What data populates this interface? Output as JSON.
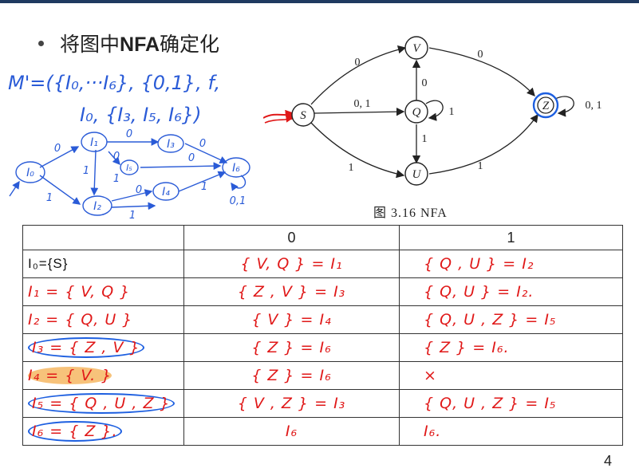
{
  "slide": {
    "bullet_prefix": "将图中",
    "bullet_bold": "NFA",
    "bullet_suffix": "确定化",
    "caption": "图 3.16   NFA",
    "page_number": "4"
  },
  "nfa": {
    "states": [
      "S",
      "V",
      "Q",
      "U",
      "Z"
    ],
    "edge_labels": {
      "s_v": "0",
      "v_z": "0",
      "s_q": "0, 1",
      "q_v": "0",
      "q_loop": "1",
      "q_u": "1",
      "s_u": "1",
      "u_z": "1",
      "z_loop": "0, 1"
    }
  },
  "notes": {
    "line1": "M'=({I₀,···I₆}, {0,1}, f,",
    "line2": "I₀, {I₃, I₅, I₆})",
    "mini_states": [
      "I₀",
      "I₁",
      "I₂",
      "I₃",
      "I₄",
      "I₅",
      "I₆"
    ],
    "mini_labels": [
      "0",
      "1",
      "1",
      "0",
      "0",
      "1",
      "0",
      "1",
      "0",
      "0",
      "1",
      "0,1"
    ]
  },
  "table": {
    "headers": [
      "",
      "0",
      "1"
    ],
    "rows": [
      {
        "state": "I₀={S}",
        "on0": "{ V, Q } = I₁",
        "on1": "{ Q , U } = I₂"
      },
      {
        "state": "I₁ = { V, Q }",
        "on0": "{ Z , V } = I₃",
        "on1": "{ Q, U } = I₂."
      },
      {
        "state": "I₂ = { Q, U }",
        "on0": "{ V } = I₄",
        "on1": "{ Q, U , Z } = I₅"
      },
      {
        "state": "I₃ = { Z , V }",
        "on0": "{ Z } = I₆",
        "on1": "{ Z } = I₆."
      },
      {
        "state": "I₄ = { V. }",
        "on0": "{ Z } = I₆",
        "on1": "×"
      },
      {
        "state": "I₅ = { Q , U , Z }",
        "on0": "{ V , Z } = I₃",
        "on1": "{ Q, U , Z } = I₅"
      },
      {
        "state": "I₆ = { Z }.",
        "on0": "I₆",
        "on1": "I₆."
      }
    ]
  },
  "colors": {
    "annotation_red": "#e01818",
    "annotation_blue": "#2a5bd7",
    "top_band": "#1f3a60"
  }
}
